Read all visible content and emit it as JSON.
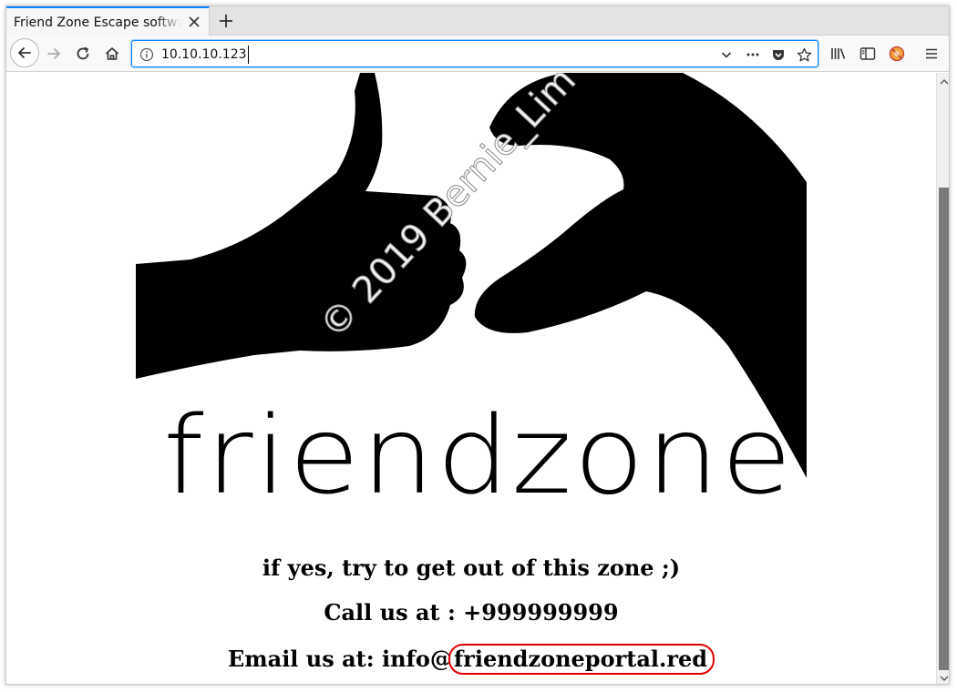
{
  "browser": {
    "tab": {
      "title": "Friend Zone Escape software"
    },
    "address": {
      "url": "10.10.10.123"
    }
  },
  "page": {
    "hero": {
      "word": "friendzone",
      "watermark": "© 2019 Bernie_Lim"
    },
    "line1": "if yes, try to get out of this zone ;)",
    "line2": "Call us at : +999999999",
    "line3": {
      "prefix": "Email us at: info@",
      "domain": "friendzoneportal.red"
    }
  },
  "icons": [
    "back-arrow-icon",
    "forward-arrow-icon",
    "reload-icon",
    "home-icon",
    "info-icon",
    "dropdown-chevron-icon",
    "more-dots-icon",
    "pocket-icon",
    "bookmark-star-icon",
    "library-icon",
    "sidebar-icon",
    "extension-icon",
    "hamburger-menu-icon",
    "close-icon",
    "plus-icon"
  ],
  "colors": {
    "tab_accent": "#0a84ff",
    "url_focus": "#0a84ff",
    "highlight": "#e00000"
  }
}
